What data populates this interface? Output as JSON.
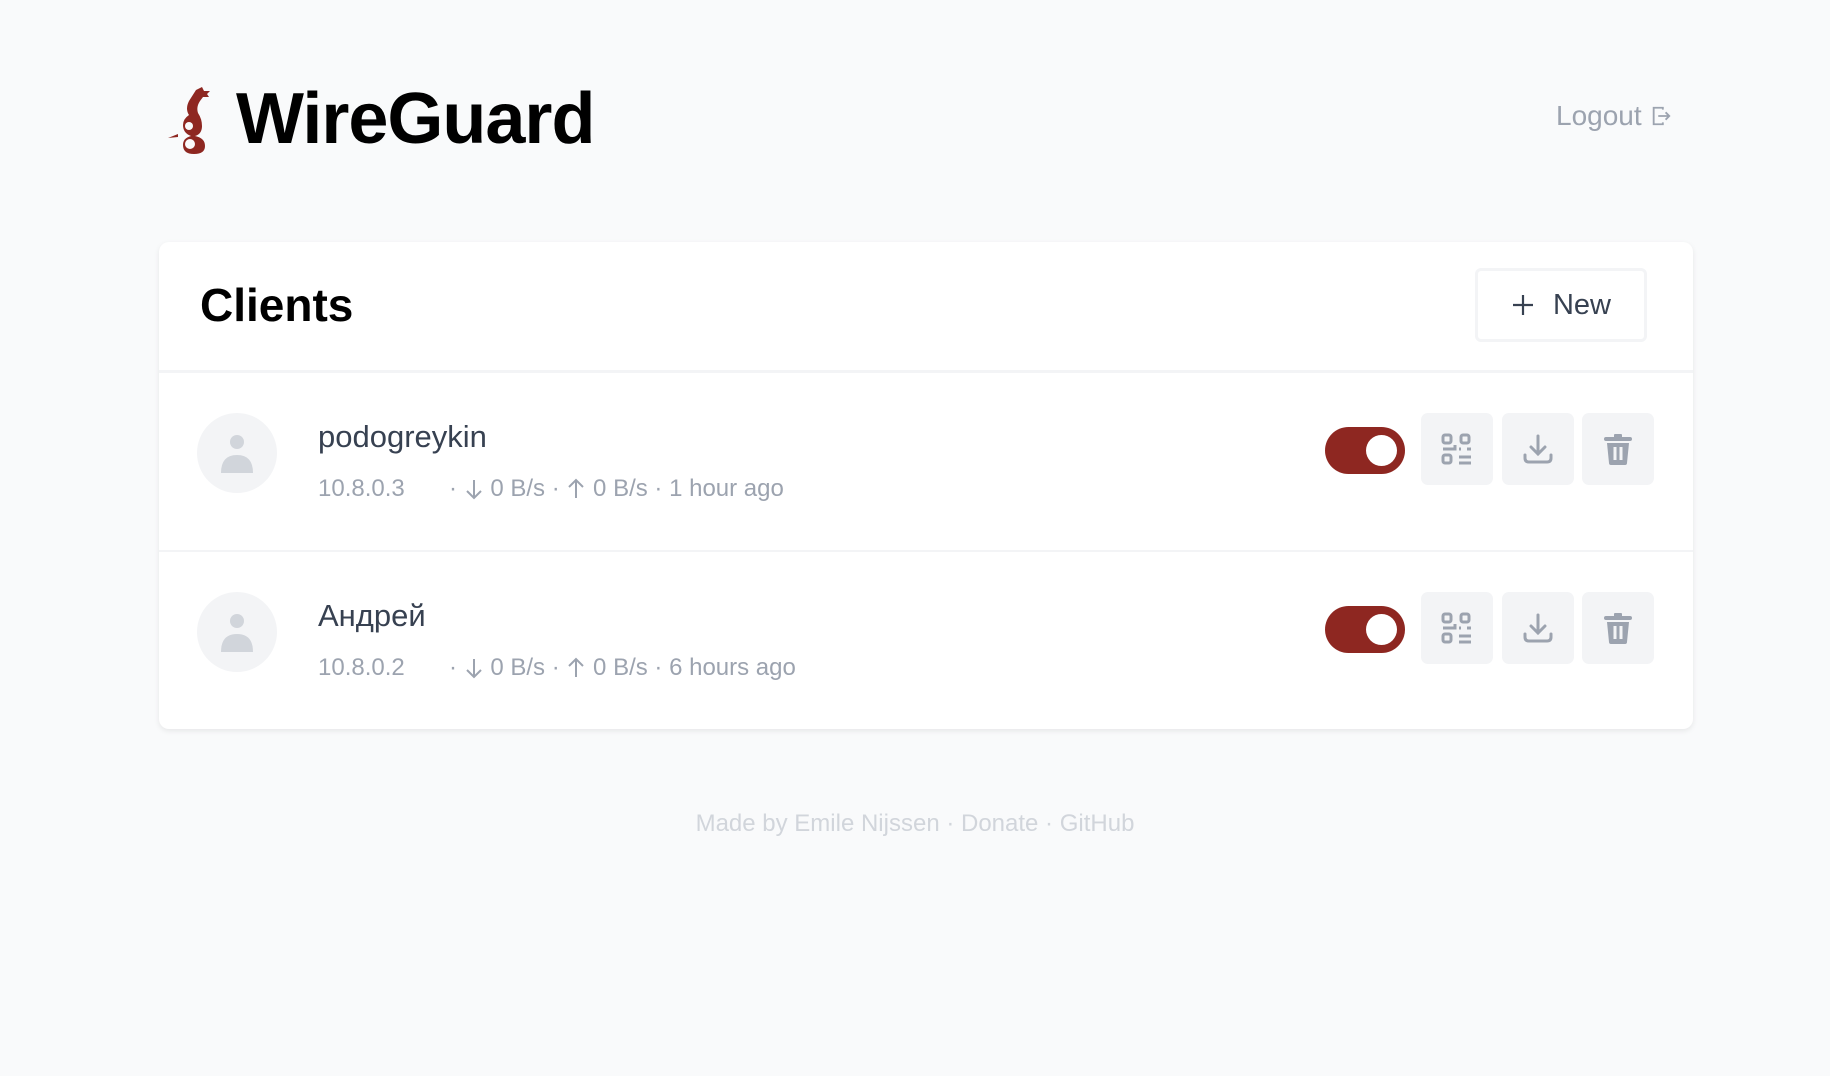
{
  "header": {
    "title": "WireGuard",
    "logout_label": "Logout"
  },
  "clients_card": {
    "title": "Clients",
    "new_label": "New"
  },
  "clients": [
    {
      "name": "podogreykin",
      "address": "10.8.0.3",
      "download": "0 B/s",
      "upload": "0 B/s",
      "last_seen": "1 hour ago",
      "enabled": true
    },
    {
      "name": "Андрей",
      "address": "10.8.0.2",
      "download": "0 B/s",
      "upload": "0 B/s",
      "last_seen": "6 hours ago",
      "enabled": true
    }
  ],
  "footer": {
    "made_by": "Made by Emile Nijssen",
    "sep": " · ",
    "donate": "Donate",
    "github": "GitHub"
  },
  "colors": {
    "accent": "#8e2721",
    "background": "#f9fafb",
    "muted": "#9ca3af"
  },
  "icons": [
    "wireguard-logo",
    "logout-icon",
    "plus-icon",
    "user-icon",
    "qr-code-icon",
    "download-icon",
    "trash-icon"
  ]
}
